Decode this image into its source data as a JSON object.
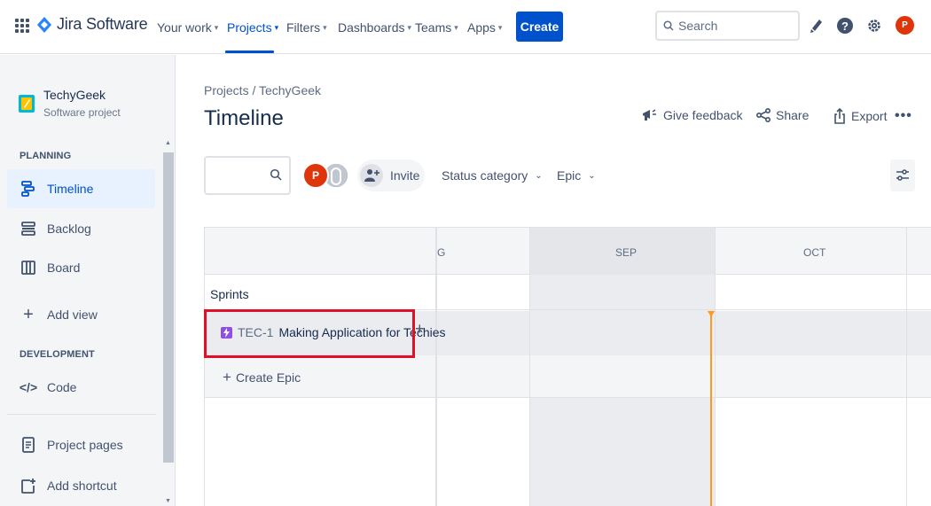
{
  "topnav": {
    "brand": "Jira Software",
    "items": [
      {
        "label": "Your work"
      },
      {
        "label": "Projects"
      },
      {
        "label": "Filters"
      },
      {
        "label": "Dashboards"
      },
      {
        "label": "Teams"
      },
      {
        "label": "Apps"
      }
    ],
    "create_label": "Create",
    "search_placeholder": "Search",
    "avatar_initial": "P"
  },
  "sidebar": {
    "project_name": "TechyGeek",
    "project_type": "Software project",
    "sections": {
      "planning": "PLANNING",
      "development": "DEVELOPMENT"
    },
    "items": {
      "timeline": "Timeline",
      "backlog": "Backlog",
      "board": "Board",
      "add_view": "Add view",
      "code": "Code",
      "project_pages": "Project pages",
      "add_shortcut": "Add shortcut"
    }
  },
  "main": {
    "breadcrumb": "Projects  /  TechyGeek",
    "title": "Timeline",
    "actions": {
      "feedback": "Give feedback",
      "share": "Share",
      "export": "Export"
    },
    "avatar_initial": "P",
    "invite_label": "Invite",
    "filters": {
      "status_category": "Status category",
      "epic": "Epic"
    }
  },
  "timeline": {
    "months": {
      "aug_partial": "G",
      "sep": "SEP",
      "oct": "OCT"
    },
    "sprints_label": "Sprints",
    "epic": {
      "key": "TEC-1",
      "title": "Making Application for Techies"
    },
    "create_epic_label": "Create Epic"
  },
  "colors": {
    "brand_blue": "#0052cc",
    "today_line": "#ff991f",
    "epic_purple": "#904ee2",
    "highlight_red": "#e0102a"
  }
}
